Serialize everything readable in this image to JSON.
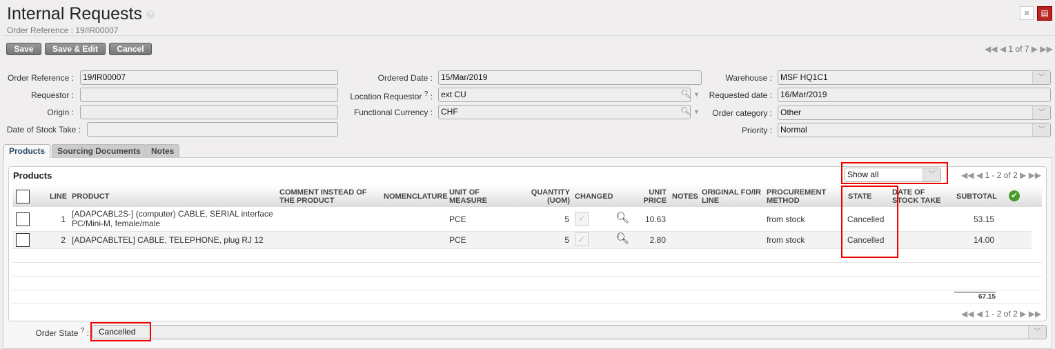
{
  "header": {
    "title": "Internal Requests",
    "help": "?",
    "subtitle": "Order Reference : 19/IR00007"
  },
  "toolbar": {
    "save": "Save",
    "save_edit": "Save & Edit",
    "cancel": "Cancel",
    "pager": "1 of 7"
  },
  "form": {
    "order_reference": {
      "label": "Order Reference :",
      "value": "19/IR00007"
    },
    "requestor": {
      "label": "Requestor :",
      "value": ""
    },
    "origin": {
      "label": "Origin :",
      "value": ""
    },
    "date_stock_take": {
      "label": "Date of Stock Take :",
      "value": ""
    },
    "ordered_date": {
      "label": "Ordered Date :",
      "value": "15/Mar/2019"
    },
    "location_requestor": {
      "label": "Location Requestor",
      "help": "?",
      "value": "ext CU"
    },
    "functional_currency": {
      "label": "Functional Currency :",
      "value": "CHF"
    },
    "warehouse": {
      "label": "Warehouse :",
      "value": "MSF HQ1C1"
    },
    "requested_date": {
      "label": "Requested date :",
      "value": "16/Mar/2019"
    },
    "order_category": {
      "label": "Order category :",
      "value": "Other"
    },
    "priority": {
      "label": "Priority :",
      "value": "Normal"
    }
  },
  "tabs": [
    "Products",
    "Sourcing Documents",
    "Notes"
  ],
  "products": {
    "title": "Products",
    "filter": "Show all",
    "pager": "1 - 2 of 2",
    "columns": {
      "line": "LINE",
      "product": "PRODUCT",
      "comment": "COMMENT INSTEAD OF THE PRODUCT",
      "nomenclature": "NOMENCLATURE",
      "uom": "UNIT OF MEASURE",
      "qty": "QUANTITY (UOM)",
      "changed": "CHANGED",
      "price": "UNIT PRICE",
      "notes": "NOTES",
      "orig": "ORIGINAL FO/IR LINE",
      "proc": "PROCUREMENT METHOD",
      "state": "STATE",
      "dst": "DATE OF STOCK TAKE",
      "subtotal": "SUBTOTAL"
    },
    "rows": [
      {
        "line": "1",
        "product": "[ADAPCABL2S-] (computer) CABLE, SERIAL interface PC/Mini-M, female/male",
        "uom": "PCE",
        "qty": "5",
        "price": "10.63",
        "proc": "from stock",
        "state": "Cancelled",
        "subtotal": "53.15"
      },
      {
        "line": "2",
        "product": "[ADAPCABLTEL] CABLE, TELEPHONE, plug RJ 12",
        "uom": "PCE",
        "qty": "5",
        "price": "2.80",
        "proc": "from stock",
        "state": "Cancelled",
        "subtotal": "14.00"
      }
    ],
    "total": "67.15"
  },
  "order_state": {
    "label": "Order State",
    "help": "?",
    "value": "Cancelled"
  }
}
